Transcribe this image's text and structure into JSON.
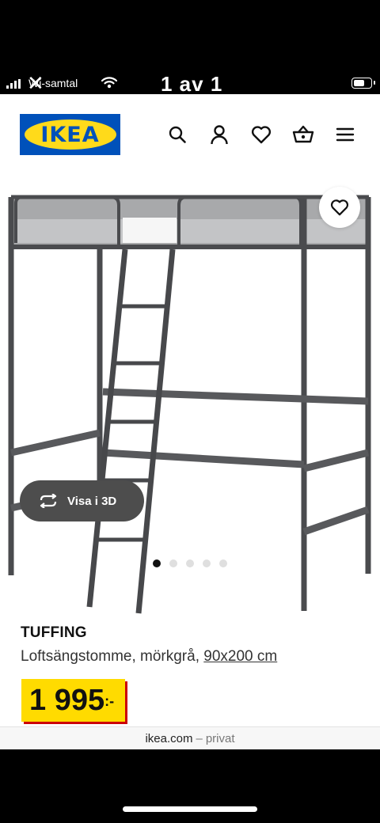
{
  "status_bar": {
    "carrier": "Wi-samtal",
    "counter": "1 av 1"
  },
  "header": {
    "logo_text": "IKEA",
    "icons": [
      "search-icon",
      "user-icon",
      "heart-icon",
      "basket-icon",
      "menu-icon"
    ]
  },
  "gallery": {
    "visa_3d_label": "Visa i 3D",
    "image_count": 5,
    "active_index": 0
  },
  "product": {
    "name": "TUFFING",
    "description": "Loftsängstomme, mörkgrå,",
    "size_link": "90x200 cm",
    "price_main": "1 995",
    "price_suffix": ":-"
  },
  "browser": {
    "domain": "ikea.com",
    "separator": "–",
    "mode": "privat"
  },
  "colors": {
    "ikea_blue": "#0051ba",
    "ikea_yellow": "#ffda1a",
    "price_red": "#cc0008",
    "frame_grey": "#4a4b4e"
  }
}
